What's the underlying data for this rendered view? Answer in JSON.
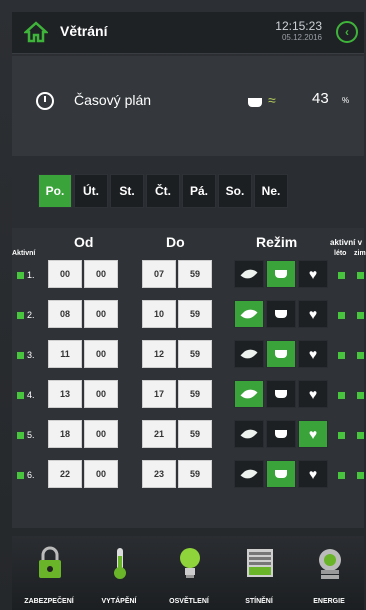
{
  "header": {
    "title": "Větrání",
    "time": "12:15:23",
    "date": "05.12.2016"
  },
  "schedule": {
    "label": "Časový plán",
    "value": "43",
    "unit": "%"
  },
  "days": [
    "Po.",
    "Út.",
    "St.",
    "Čt.",
    "Pá.",
    "So.",
    "Ne."
  ],
  "active_day": "Po.",
  "table": {
    "col_from": "Od",
    "col_to": "Do",
    "col_mode": "Režim",
    "col_active": "Aktivní",
    "col_active_season": "aktivní v",
    "summer": "léto",
    "winter": "zim",
    "rows": [
      {
        "num": "1.",
        "from_h": "00",
        "from_m": "00",
        "to_h": "07",
        "to_m": "59",
        "mode": "cup"
      },
      {
        "num": "2.",
        "from_h": "08",
        "from_m": "00",
        "to_h": "10",
        "to_m": "59",
        "mode": "leaf"
      },
      {
        "num": "3.",
        "from_h": "11",
        "from_m": "00",
        "to_h": "12",
        "to_m": "59",
        "mode": "cup"
      },
      {
        "num": "4.",
        "from_h": "13",
        "from_m": "00",
        "to_h": "17",
        "to_m": "59",
        "mode": "leaf"
      },
      {
        "num": "5.",
        "from_h": "18",
        "from_m": "00",
        "to_h": "21",
        "to_m": "59",
        "mode": "heart"
      },
      {
        "num": "6.",
        "from_h": "22",
        "from_m": "00",
        "to_h": "23",
        "to_m": "59",
        "mode": "cup"
      }
    ]
  },
  "nav": [
    {
      "label": "ZABEZPEČENÍ",
      "icon": "lock-icon"
    },
    {
      "label": "VYTÁPĚNÍ",
      "icon": "thermometer-icon"
    },
    {
      "label": "OSVĚTLENÍ",
      "icon": "bulb-icon"
    },
    {
      "label": "STÍNĚNÍ",
      "icon": "blinds-icon"
    },
    {
      "label": "ENERGIE",
      "icon": "energy-icon"
    }
  ],
  "colors": {
    "accent": "#3aa33a",
    "bg": "#2a2d30"
  }
}
